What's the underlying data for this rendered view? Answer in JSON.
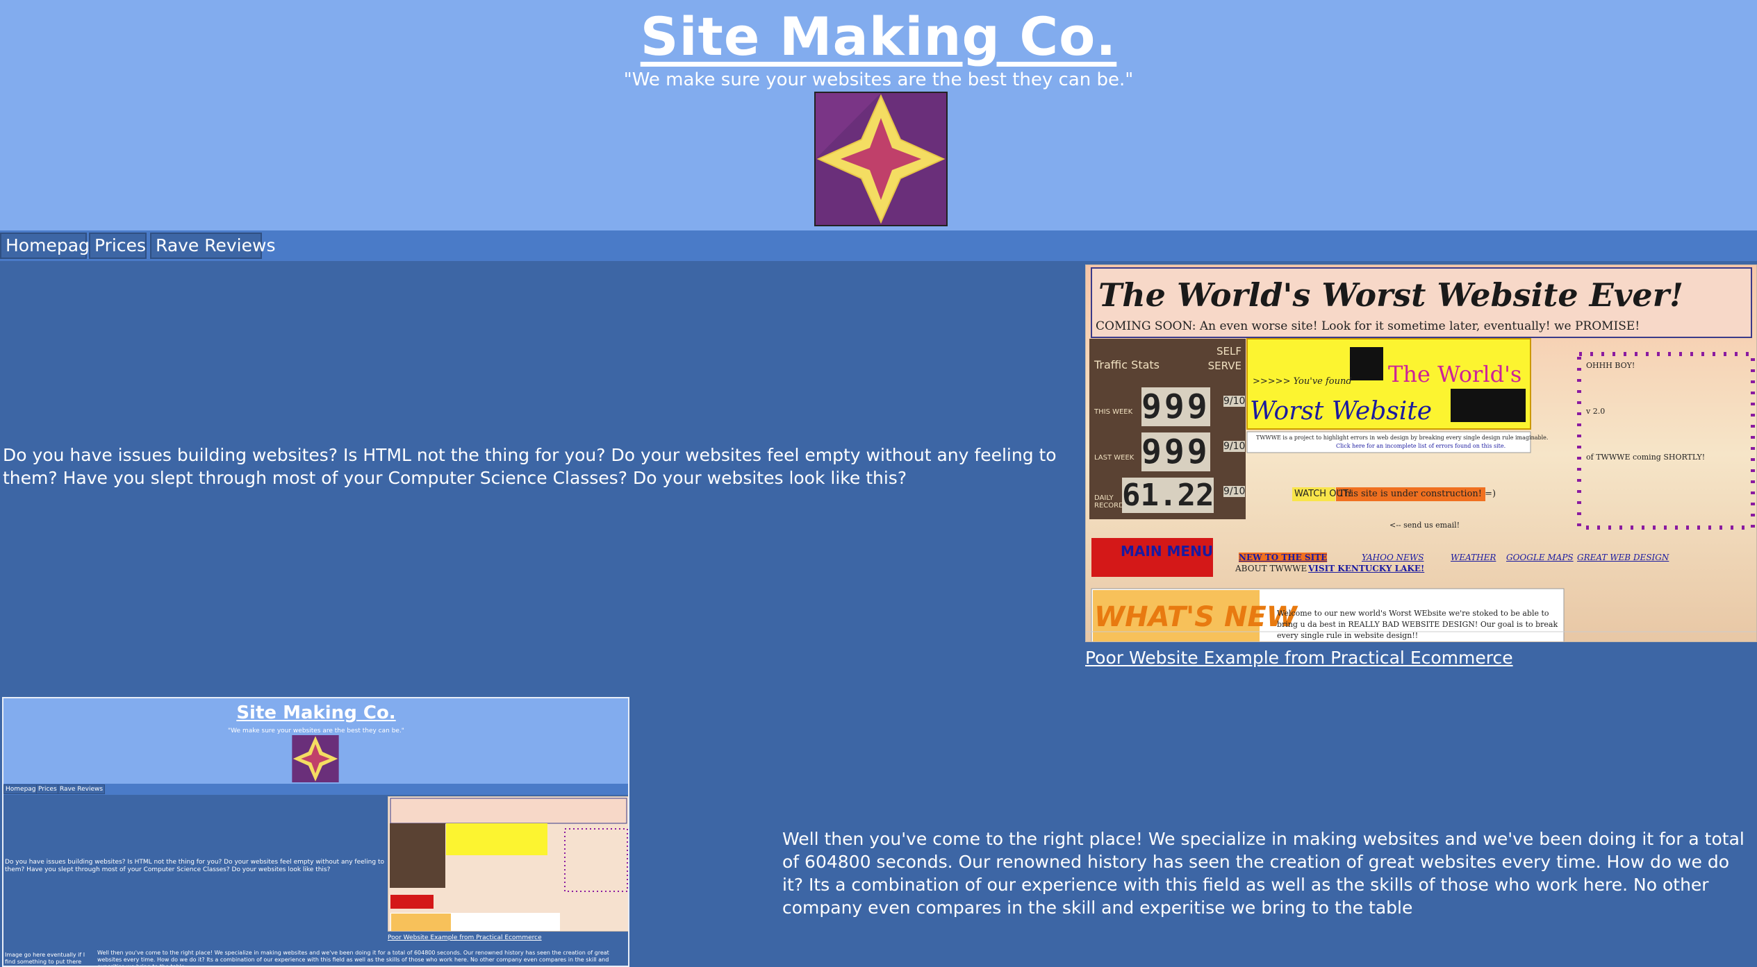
{
  "header": {
    "title": "Site Making Co.",
    "tagline": "\"We make sure your websites are the best they can be.\"",
    "logo_icon": "four-point-star-logo"
  },
  "nav": {
    "items": [
      {
        "label": "Homepage"
      },
      {
        "label": "Prices"
      },
      {
        "label": "Rave Reviews"
      }
    ]
  },
  "main": {
    "intro_text": "Do you have issues building websites? Is HTML not the thing for you? Do your websites feel empty without any feeling to them? Have you slept through most of your Computer Science Classes? Do your websites look like this?",
    "example_caption": "Poor Website Example from Practical Ecommerce",
    "second_text": "Well then you've come to the right place! We specialize in making websites and we've been doing it for a total of 604800 seconds. Our renowned history has seen the creation of great websites every time. How do we do it? Its a combination of our experience with this field as well as the skills of those who work here. No other company even compares in the skill and experitise we bring to the table"
  },
  "example_site": {
    "banner_title": "The World's Worst Website Ever!",
    "coming_soon": "COMING SOON: An even worse site! Look for it sometime later, eventually!  we PROMISE!",
    "traffic_stats_label": "Traffic Stats",
    "self_serve_label": "SELF SERVE",
    "this_week_label": "THIS WEEK",
    "last_week_label": "LAST WEEK",
    "daily_record_label": "DAILY RECORD",
    "this_week_value": "999",
    "last_week_value": "999",
    "daily_record_value": "61.22",
    "fraction": "9/10",
    "youve_found": ">>>>> You've found",
    "worlds_label": "The World's",
    "worst_label": "Worst Website",
    "project_note": "TWWWE is a project to highlight errors in web design by breaking every single design rule imaginable.",
    "click_here": "Click here for an incomplete list of errors found on this site.",
    "watch_out": "WATCH OUT!",
    "under_construction": "This site is under construction! =)",
    "send_email": "<-- send us email!",
    "ohhh_boy": "OHHH BOY!",
    "version": "v 2.0",
    "coming_shortly": "of TWWWE coming SHORTLY!",
    "main_menu": "MAIN MENU",
    "nav_links": [
      "NEW TO THE SITE",
      "YAHOO NEWS",
      "WEATHER",
      "GOOGLE MAPS",
      "GREAT WEB DESIGN"
    ],
    "about_label": "ABOUT TWWWE",
    "kentucky_link": "VISIT KENTUCKY LAKE!",
    "whats_new": "WHAT'S NEW",
    "welcome_text": "Welcome to our new world's Worst WEbsite          we're stoked to be able to bring u da best in REALLY BAD WEBSITE DESIGN!  Our goal is to break every single rule in website design!!"
  },
  "mini_preview": {
    "image_note": "Image go here eventually if I find something to put there"
  },
  "colors": {
    "header_bg": "#82acee",
    "navbar_bg": "#4a7bc8",
    "page_bg": "#3d66a5",
    "logo_bg": "#6a2f7a",
    "logo_star_outer": "#f4dd62",
    "logo_star_inner": "#c0406a"
  }
}
